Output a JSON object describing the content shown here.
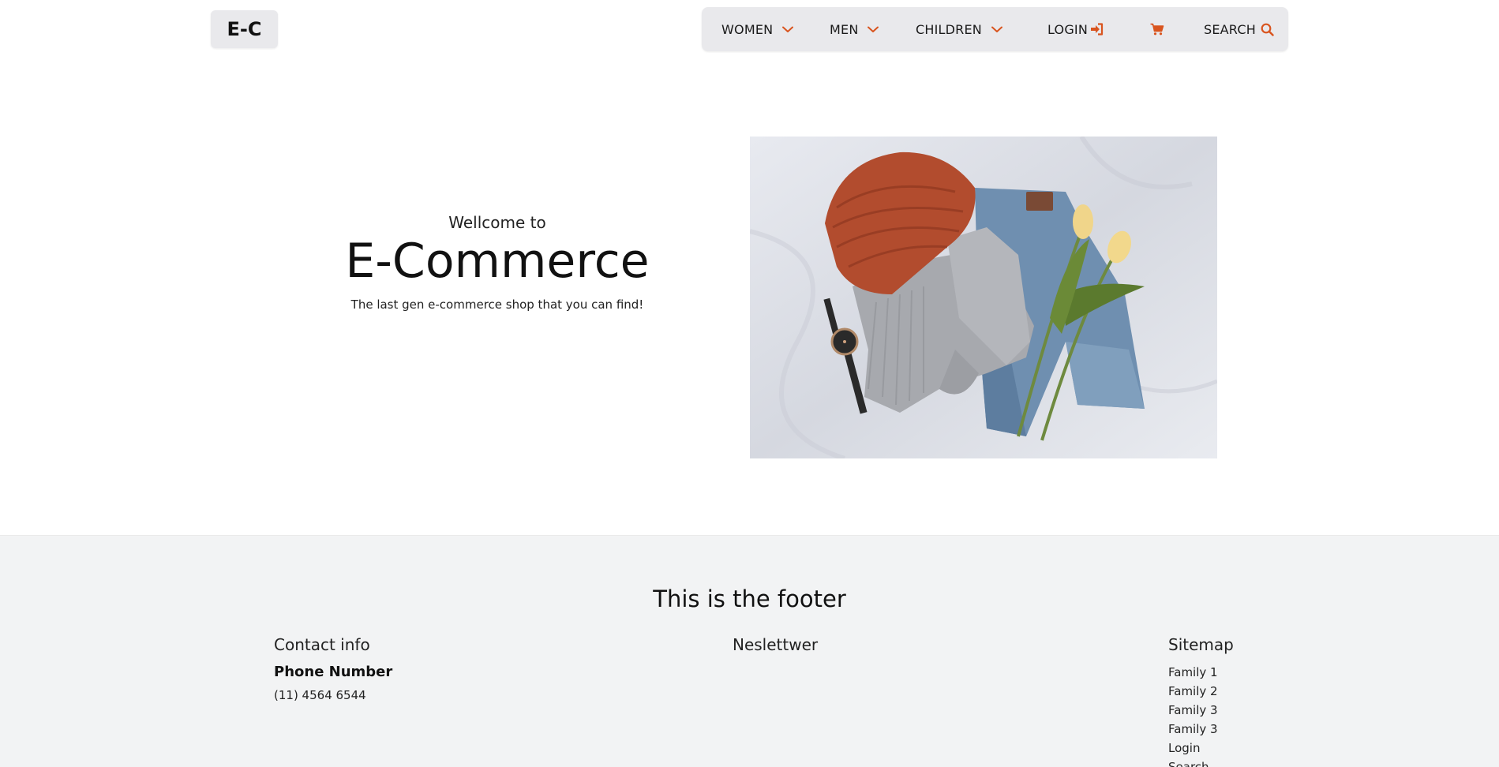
{
  "header": {
    "logo": "E-C",
    "nav": {
      "women": "WOMEN",
      "men": "MEN",
      "children": "CHILDREN",
      "login": "LOGIN",
      "search": "SEARCH"
    },
    "icons": {
      "chevron": "chevron-down-icon",
      "login": "sign-in-icon",
      "cart": "shopping-cart-icon",
      "search": "magnifier-icon"
    },
    "accent_color": "#d9541e"
  },
  "hero": {
    "welcome": "Wellcome to",
    "title": "E-Commerce",
    "tagline": "The last gen e-commerce shop that you can find!"
  },
  "footer": {
    "title": "This is the footer",
    "contact": {
      "title": "Contact info",
      "phone_label": "Phone Number",
      "phone_value": "(11) 4564 6544"
    },
    "newsletter": {
      "title": "Neslettwer"
    },
    "sitemap": {
      "title": "Sitemap",
      "links": [
        "Family 1",
        "Family 2",
        "Family 3",
        "Family 3",
        "Login",
        "Search"
      ]
    }
  }
}
